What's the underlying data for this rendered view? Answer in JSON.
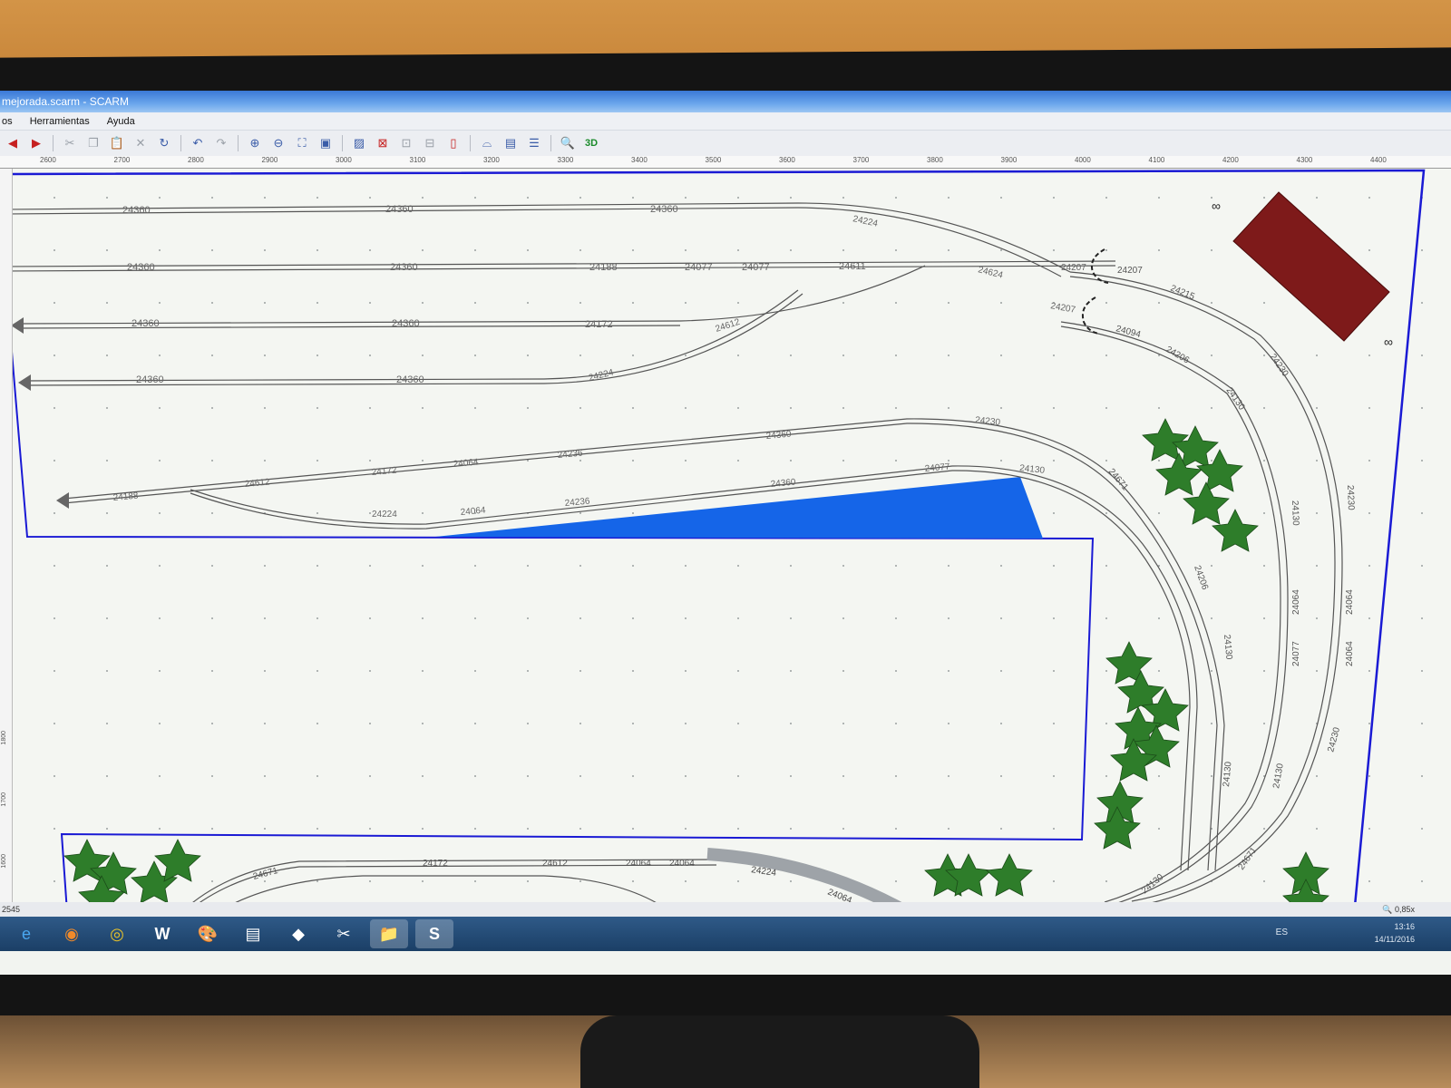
{
  "window": {
    "title": "mejorada.scarm - SCARM"
  },
  "menu": {
    "items": [
      "os",
      "Herramientas",
      "Ayuda"
    ]
  },
  "toolbar": {
    "threed_label": "3D"
  },
  "ruler": {
    "ticks": [
      "2600",
      "2700",
      "2800",
      "2900",
      "3000",
      "3100",
      "3200",
      "3300",
      "3400",
      "3500",
      "3600",
      "3700",
      "3800",
      "3900",
      "4000",
      "4100",
      "4200",
      "4300",
      "4400"
    ]
  },
  "vruler": {
    "ticks": [
      "1800",
      "1700",
      "1600"
    ]
  },
  "tracks": {
    "r1": [
      "24360",
      "24360",
      "24360",
      "24224"
    ],
    "r2": [
      "24360",
      "24360",
      "24188",
      "24077",
      "24077",
      "24611",
      "24624"
    ],
    "r3": [
      "24360",
      "24360",
      "24172",
      "24612"
    ],
    "r4": [
      "24360",
      "24360",
      "24224"
    ],
    "r5": [
      "24188",
      "24612",
      "24172",
      "24064",
      "24236",
      "24360",
      "24230"
    ],
    "r6": [
      "24224",
      "24064",
      "24236",
      "24360",
      "24077",
      "24130"
    ],
    "turnouts": [
      "24207",
      "24207",
      "24207",
      "24215",
      "24094",
      "24206",
      "24230"
    ],
    "curve_right": [
      "24130",
      "24671",
      "24230",
      "24130",
      "24206",
      "24064",
      "24064",
      "24130",
      "24077",
      "24064",
      "24230",
      "24130",
      "24130",
      "24671",
      "24130"
    ],
    "bottom": [
      "24671",
      "24172",
      "24612",
      "24064",
      "24064",
      "24224",
      "24064"
    ]
  },
  "statusbar": {
    "coord": "2545",
    "zoom": "0,85x"
  },
  "taskbar": {
    "lang": "ES",
    "time": "13:16",
    "date": "14/11/2016"
  },
  "colors": {
    "building": "#7e1a1a",
    "water": "#1565e8",
    "trees": "#2e7d2a",
    "border": "#1a1ad4"
  }
}
